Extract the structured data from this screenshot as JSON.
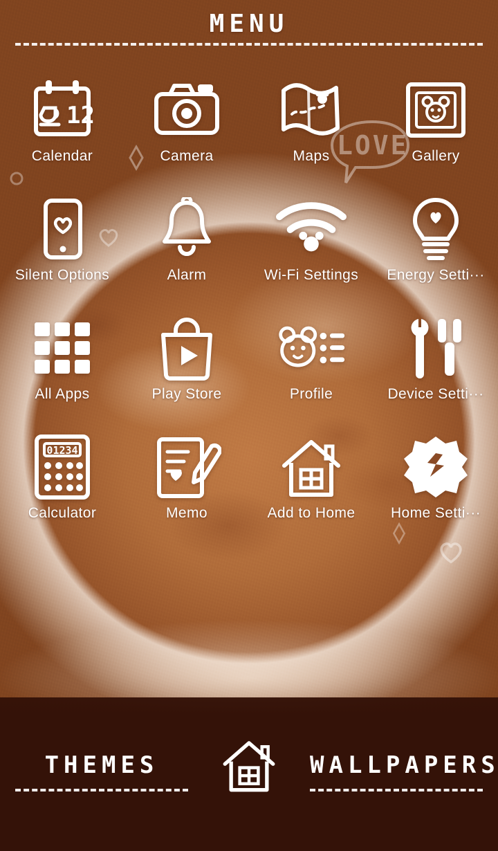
{
  "header": {
    "title": "MENU"
  },
  "wallpaper": {
    "description": "coffee latte art photo",
    "decorations": [
      "LOVE speech bubble",
      "heart",
      "diamond sparkle"
    ],
    "love_text": "LOVE"
  },
  "colors": {
    "icon": "#ffffff",
    "background_top": "#9c5128",
    "background_bottom": "#3a1408",
    "bottom_bar": "#341208"
  },
  "grid": {
    "items": [
      {
        "label": "Calendar",
        "icon": "calendar-icon"
      },
      {
        "label": "Camera",
        "icon": "camera-icon"
      },
      {
        "label": "Maps",
        "icon": "map-icon"
      },
      {
        "label": "Gallery",
        "icon": "gallery-icon"
      },
      {
        "label": "Silent Options",
        "icon": "phone-heart-icon"
      },
      {
        "label": "Alarm",
        "icon": "bell-icon"
      },
      {
        "label": "Wi-Fi Settings",
        "icon": "wifi-icon"
      },
      {
        "label": "Energy Setti···",
        "icon": "lightbulb-icon"
      },
      {
        "label": "All Apps",
        "icon": "grid-apps-icon"
      },
      {
        "label": "Play Store",
        "icon": "play-store-icon"
      },
      {
        "label": "Profile",
        "icon": "bear-profile-icon"
      },
      {
        "label": "Device Setti···",
        "icon": "tools-icon"
      },
      {
        "label": "Calculator",
        "icon": "calculator-icon"
      },
      {
        "label": "Memo",
        "icon": "memo-pencil-icon"
      },
      {
        "label": "Add to Home",
        "icon": "house-icon"
      },
      {
        "label": "Home Setti···",
        "icon": "gear-icon"
      }
    ]
  },
  "calculator": {
    "display": "01234"
  },
  "calendar": {
    "day": "12"
  },
  "bottom": {
    "themes_label": "THEMES",
    "wallpapers_label": "WALLPAPERS",
    "home_icon": "home-icon"
  }
}
